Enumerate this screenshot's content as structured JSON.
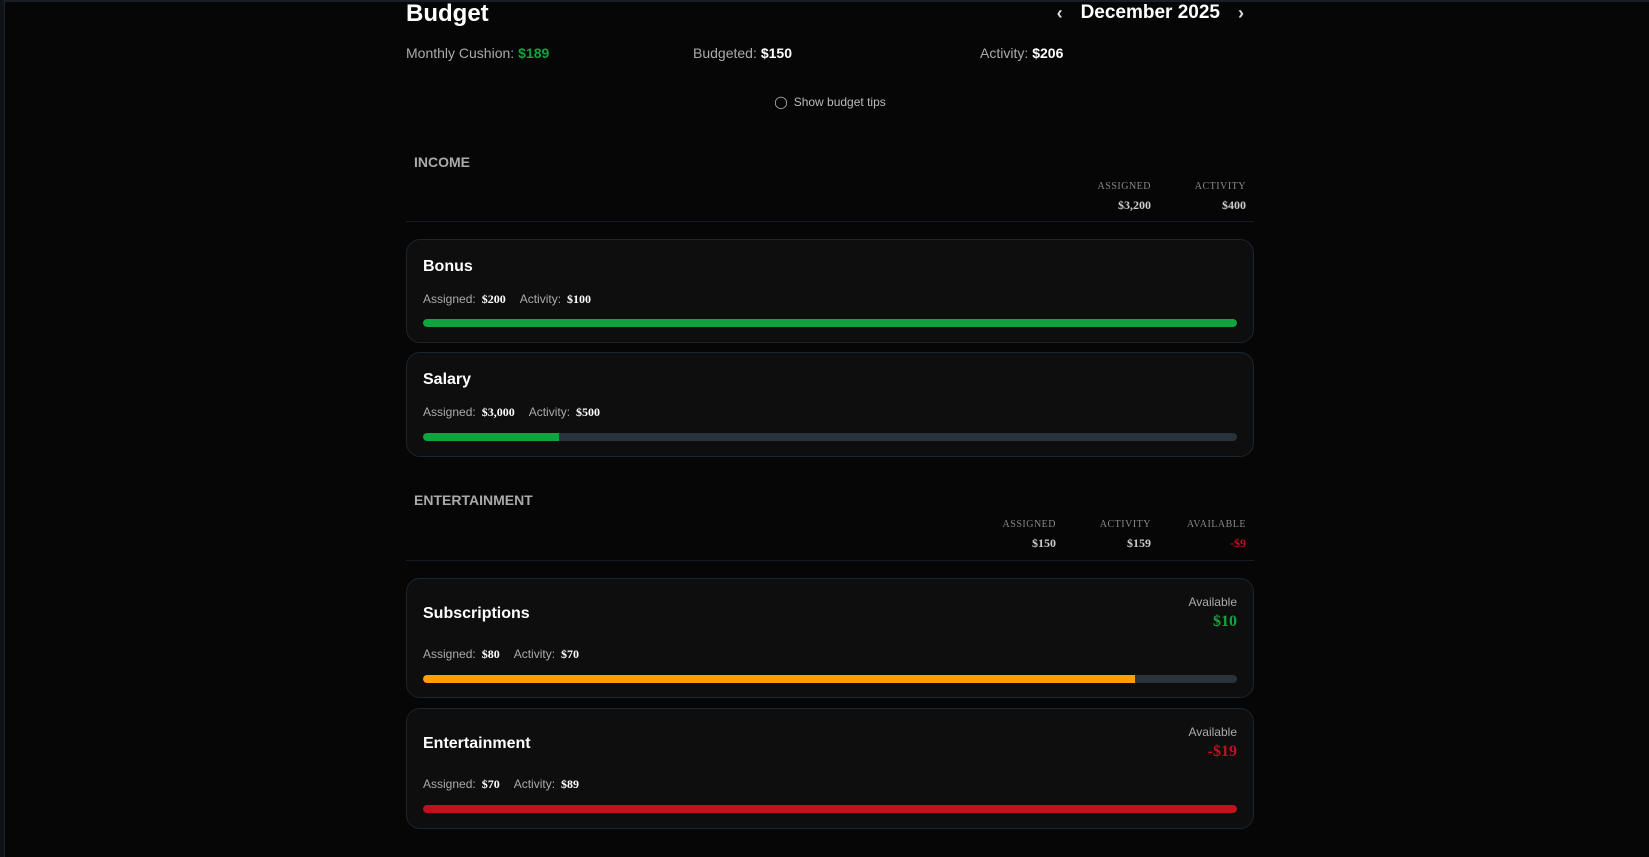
{
  "header": {
    "title": "Budget",
    "month": "December 2025"
  },
  "stats": {
    "cushion_label": "Monthly Cushion:",
    "cushion": "$189",
    "budgeted_label": "Budgeted:",
    "budgeted": "$150",
    "activity_label": "Activity:",
    "activity": "$206"
  },
  "tips": "Show budget tips",
  "income": {
    "title": "INCOME",
    "assigned_label": "ASSIGNED",
    "assigned": "$3,200",
    "activity_label": "ACTIVITY",
    "activity": "$400",
    "items": [
      {
        "name": "Bonus",
        "assigned_label": "Assigned:",
        "assigned": "$200",
        "activity_label": "Activity:",
        "activity": "$100",
        "progress": 1.0,
        "color": "#0ea53e"
      },
      {
        "name": "Salary",
        "assigned_label": "Assigned:",
        "assigned": "$3,000",
        "activity_label": "Activity:",
        "activity": "$500",
        "progress": 0.167,
        "color": "#0ea53e"
      }
    ]
  },
  "entertainment": {
    "title": "ENTERTAINMENT",
    "assigned_label": "ASSIGNED",
    "assigned": "$150",
    "activity_label": "ACTIVITY",
    "activity": "$159",
    "available_label": "AVAILABLE",
    "available": "-$9",
    "items": [
      {
        "name": "Subscriptions",
        "available_label": "Available",
        "available": "$10",
        "assigned_label": "Assigned:",
        "assigned": "$80",
        "activity_label": "Activity:",
        "activity": "$70",
        "progress": 0.875,
        "color": "#ff9f00"
      },
      {
        "name": "Entertainment",
        "available_label": "Available",
        "available": "-$19",
        "assigned_label": "Assigned:",
        "assigned": "$70",
        "activity_label": "Activity:",
        "activity": "$89",
        "progress": 1.0,
        "color": "#c3101f"
      }
    ]
  }
}
